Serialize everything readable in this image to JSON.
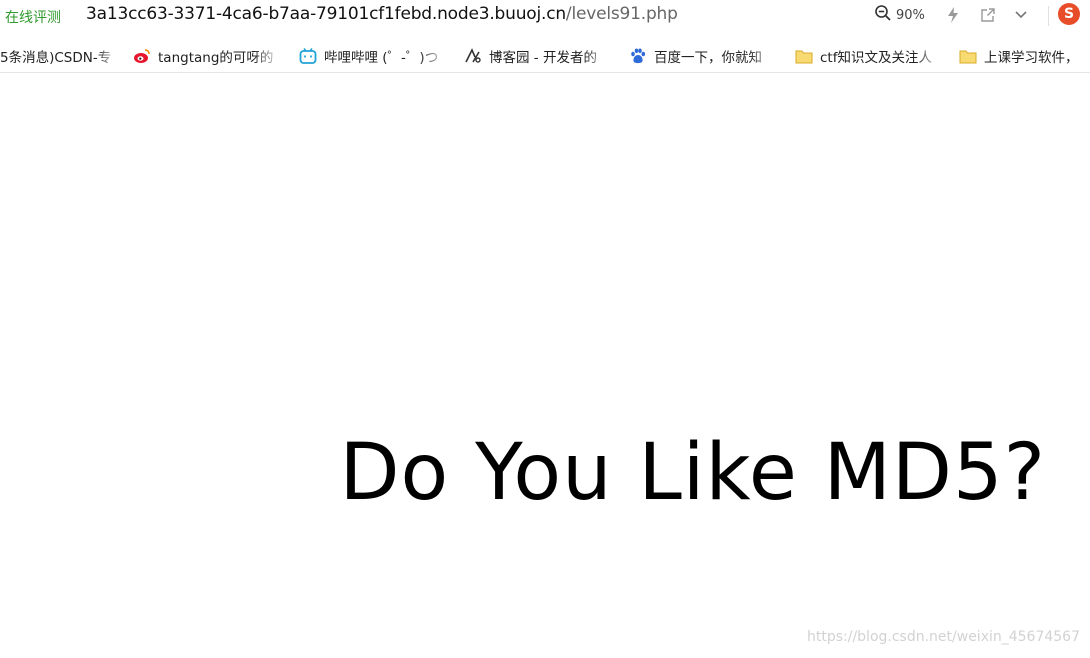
{
  "address_bar": {
    "site_tag": "在线评测",
    "url_host": "3a13cc63-3371-4ca6-b7aa-79101cf1febd.node3.buuoj.cn",
    "url_path": "/levels91.php",
    "zoom_level": "90%",
    "icons": [
      "zoom-out-icon",
      "lightning-icon",
      "share-icon",
      "chevron-down-icon",
      "sogou-icon"
    ]
  },
  "bookmarks": [
    {
      "label": "5条消息)CSDN-专",
      "icon": "none"
    },
    {
      "label": "tangtang的可呀的",
      "icon": "weibo-icon"
    },
    {
      "label": "哔哩哔哩 (゜-゜)つ",
      "icon": "bilibili-icon"
    },
    {
      "label": "博客园 - 开发者的",
      "icon": "cnblogs-icon"
    },
    {
      "label": "百度一下，你就知",
      "icon": "baidu-icon"
    },
    {
      "label": "ctf知识文及关注人",
      "icon": "folder-icon"
    },
    {
      "label": "上课学习软件，",
      "icon": "folder-icon"
    }
  ],
  "colors": {
    "site_tag": "#2f9a2f",
    "folder": "#f5c94c",
    "bilibili": "#22a3d8",
    "baidu": "#2f6ad8",
    "weibo": "#e6162d",
    "sogou": "#e84d2a"
  },
  "page": {
    "headline": "Do You Like MD5?",
    "watermark": "https://blog.csdn.net/weixin_45674567"
  }
}
